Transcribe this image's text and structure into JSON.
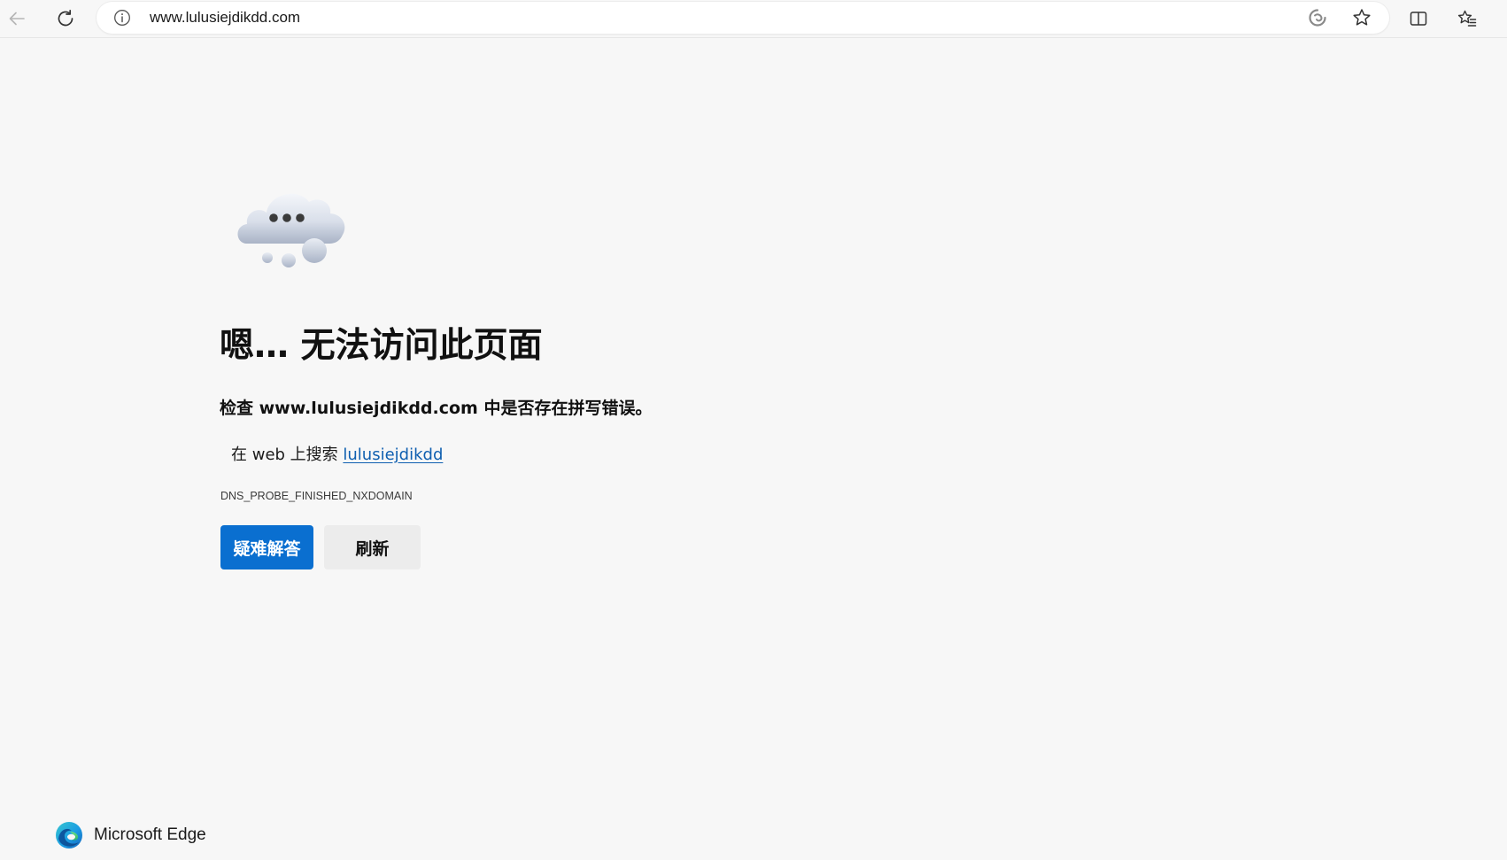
{
  "browser": {
    "url": "www.lulusiejdikdd.com",
    "icons": {
      "back": "back-arrow-icon",
      "refresh": "refresh-icon",
      "site_info": "info-icon",
      "read_aloud": "read-aloud-icon",
      "favorite": "star-icon",
      "split_screen": "split-screen-icon",
      "favorites": "favorites-list-icon"
    }
  },
  "error_page": {
    "title": "嗯… 无法访问此页面",
    "subtitle": "检查 www.lulusiejdikdd.com 中是否存在拼写错误。",
    "search_prefix": "在 web 上搜索 ",
    "search_link": "lulusiejdikdd",
    "error_code": "DNS_PROBE_FINISHED_NXDOMAIN",
    "troubleshoot_label": "疑难解答",
    "refresh_label": "刷新"
  },
  "footer": {
    "brand": "Microsoft Edge"
  },
  "colors": {
    "primary_button": "#0a6fd0",
    "link": "#0f5fb0",
    "page_background": "#f7f7f7"
  }
}
